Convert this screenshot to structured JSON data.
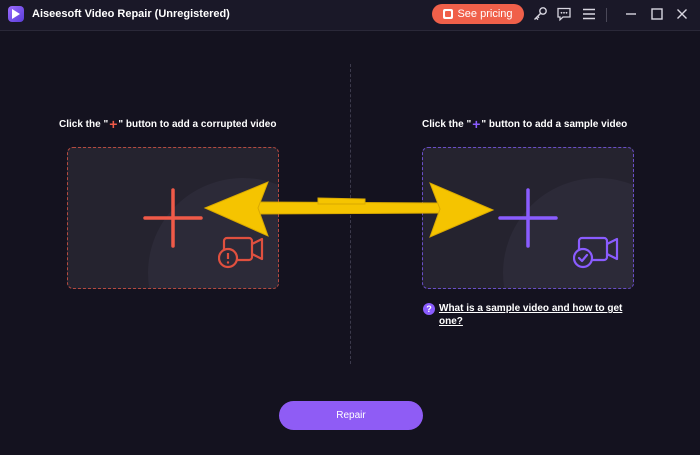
{
  "app": {
    "title": "Aiseesoft Video Repair (Unregistered)",
    "pricing_label": "See pricing",
    "icons": [
      "key-icon",
      "feedback-icon",
      "menu-icon",
      "minimize-icon",
      "maximize-icon",
      "close-icon"
    ]
  },
  "left_panel": {
    "hint_prefix": "Click the \"",
    "hint_plus": "+",
    "hint_suffix": "\" button to add a corrupted video",
    "accent": "#f05a48"
  },
  "right_panel": {
    "hint_prefix": "Click the \"",
    "hint_plus": "+",
    "hint_suffix": "\" button to add a sample video",
    "accent": "#8a5cff",
    "help_link": "What is a sample video and how to get one?"
  },
  "repair_label": "Repair",
  "colors": {
    "background": "#14121f",
    "pricing": "#f0604a",
    "repair": "#8f5cf5",
    "arrow": "#f5c400"
  }
}
